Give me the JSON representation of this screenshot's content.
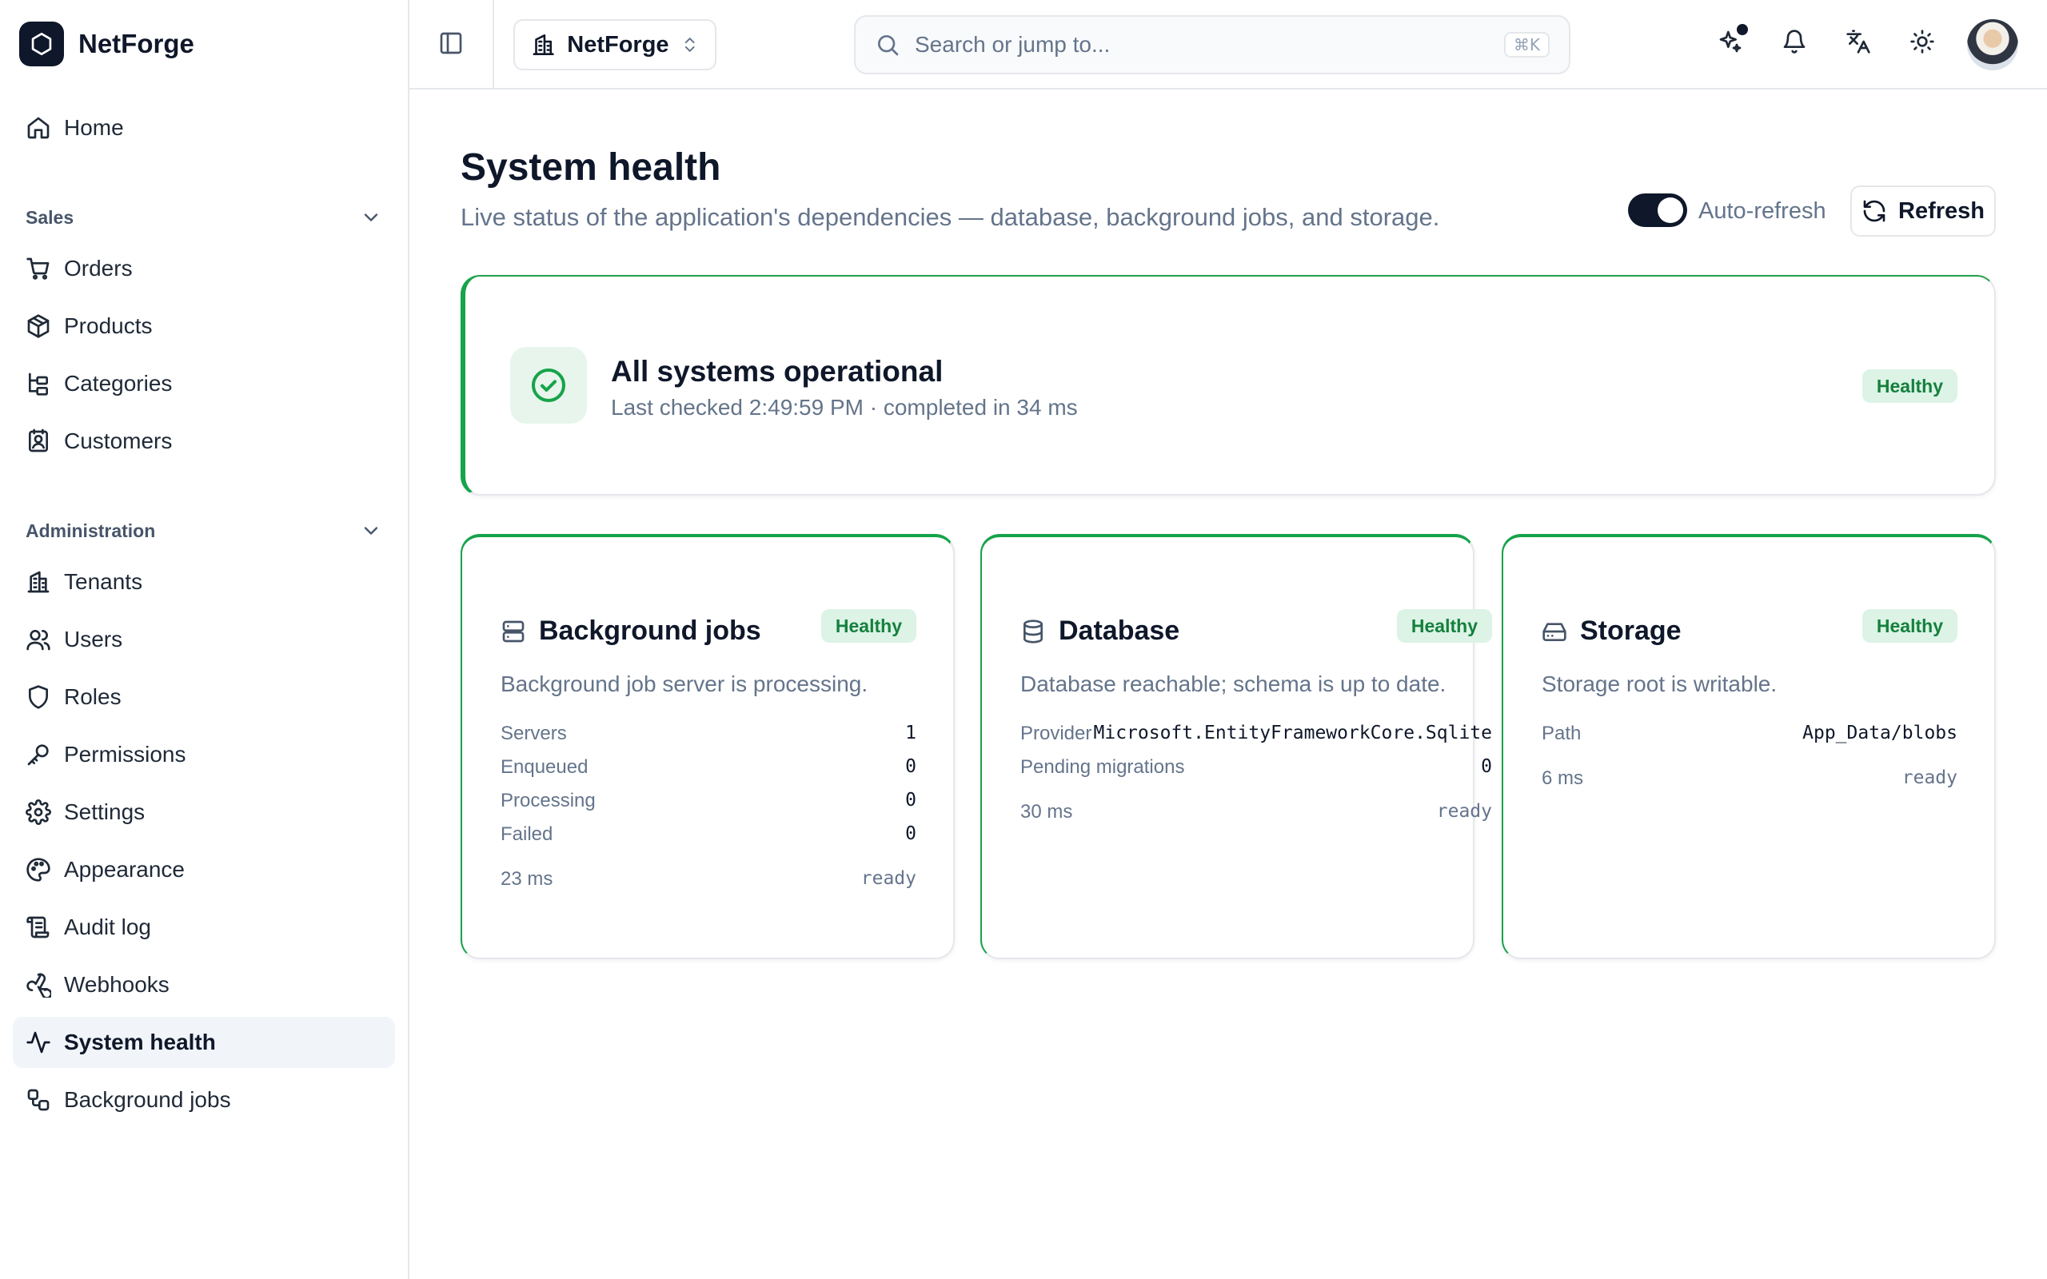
{
  "app": {
    "name": "NetForge"
  },
  "sidebar": {
    "home": "Home",
    "sales": {
      "title": "Sales",
      "items": [
        "Orders",
        "Products",
        "Categories",
        "Customers"
      ]
    },
    "admin": {
      "title": "Administration",
      "items": [
        "Tenants",
        "Users",
        "Roles",
        "Permissions",
        "Settings",
        "Appearance",
        "Audit log",
        "Webhooks",
        "System health",
        "Background jobs"
      ]
    },
    "active": "System health"
  },
  "topbar": {
    "tenant": "NetForge",
    "search_placeholder": "Search or jump to...",
    "search_shortcut": "⌘K"
  },
  "page": {
    "title": "System health",
    "subtitle": "Live status of the application's dependencies — database, background jobs, and storage.",
    "auto_refresh_label": "Auto-refresh",
    "auto_refresh_on": true,
    "refresh_label": "Refresh"
  },
  "summary": {
    "title": "All systems operational",
    "subtitle": "Last checked 2:49:59 PM · completed in 34 ms",
    "status": "Healthy"
  },
  "checks": {
    "jobs": {
      "title": "Background jobs",
      "status": "Healthy",
      "description": "Background job server is processing.",
      "rows": [
        {
          "label": "Servers",
          "value": "1"
        },
        {
          "label": "Enqueued",
          "value": "0"
        },
        {
          "label": "Processing",
          "value": "0"
        },
        {
          "label": "Failed",
          "value": "0"
        }
      ],
      "duration": "23 ms",
      "state": "ready"
    },
    "database": {
      "title": "Database",
      "status": "Healthy",
      "description": "Database reachable; schema is up to date.",
      "rows": [
        {
          "label": "Provider",
          "value": "Microsoft.EntityFrameworkCore.Sqlite"
        },
        {
          "label": "Pending migrations",
          "value": "0"
        }
      ],
      "duration": "30 ms",
      "state": "ready"
    },
    "storage": {
      "title": "Storage",
      "status": "Healthy",
      "description": "Storage root is writable.",
      "rows": [
        {
          "label": "Path",
          "value": "App_Data/blobs"
        }
      ],
      "duration": "6 ms",
      "state": "ready"
    }
  },
  "colors": {
    "accent": "#0f172a",
    "healthy": "#16a34a",
    "healthy_bg": "#dcf3e6"
  },
  "icons": [
    "hexagon-logo-icon",
    "home-icon",
    "cart-icon",
    "package-icon",
    "folder-tree-icon",
    "contact-icon",
    "building-icon",
    "users-icon",
    "shield-icon",
    "key-icon",
    "gear-icon",
    "palette-icon",
    "scroll-icon",
    "webhook-icon",
    "activity-icon",
    "workflow-icon",
    "sidebar-icon",
    "chevron-updown-icon",
    "search-icon",
    "sparkles-icon",
    "bell-icon",
    "languages-icon",
    "sun-icon",
    "refresh-icon",
    "check-circle-icon",
    "server-icon",
    "database-icon",
    "hard-drive-icon"
  ]
}
